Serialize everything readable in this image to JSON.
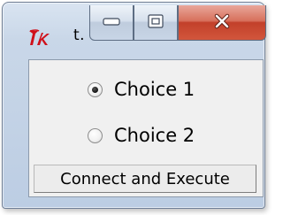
{
  "window": {
    "title": "t.",
    "app_icon": "tk-feather-icon"
  },
  "caption_buttons": {
    "minimize_icon": "minimize-icon",
    "maximize_icon": "maximize-icon",
    "close_icon": "close-icon"
  },
  "radio_group": {
    "options": [
      {
        "label": "Choice 1",
        "selected": true
      },
      {
        "label": "Choice 2",
        "selected": false
      }
    ]
  },
  "action": {
    "label": "Connect and Execute"
  },
  "colors": {
    "close_button": "#c2402a",
    "client_background": "#f0f0f0",
    "logo_red": "#d0101a"
  }
}
